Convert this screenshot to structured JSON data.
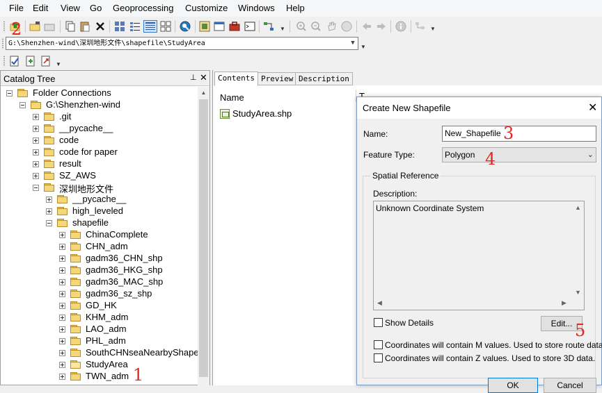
{
  "menu": [
    "File",
    "Edit",
    "View",
    "Go",
    "Geoprocessing",
    "Customize",
    "Windows",
    "Help"
  ],
  "location_path": "G:\\Shenzhen-wind\\深圳地形文件\\shapefile\\StudyArea",
  "catalog": {
    "title": "Catalog Tree",
    "pin": "⊥",
    "close": "✕",
    "nodes": [
      {
        "label": "Folder Connections",
        "level": 0,
        "expanded": true
      },
      {
        "label": "G:\\Shenzhen-wind",
        "level": 1,
        "expanded": true
      },
      {
        "label": ".git",
        "level": 2,
        "expanded": false
      },
      {
        "label": "__pycache__",
        "level": 2,
        "expanded": false
      },
      {
        "label": "code",
        "level": 2,
        "expanded": false
      },
      {
        "label": "code for paper",
        "level": 2,
        "expanded": false
      },
      {
        "label": "result",
        "level": 2,
        "expanded": false
      },
      {
        "label": "SZ_AWS",
        "level": 2,
        "expanded": false
      },
      {
        "label": "深圳地形文件",
        "level": 2,
        "expanded": true
      },
      {
        "label": "__pycache__",
        "level": 3,
        "expanded": false
      },
      {
        "label": "high_leveled",
        "level": 3,
        "expanded": false
      },
      {
        "label": "shapefile",
        "level": 3,
        "expanded": true
      },
      {
        "label": "ChinaComplete",
        "level": 4,
        "expanded": false
      },
      {
        "label": "CHN_adm",
        "level": 4,
        "expanded": false
      },
      {
        "label": "gadm36_CHN_shp",
        "level": 4,
        "expanded": false
      },
      {
        "label": "gadm36_HKG_shp",
        "level": 4,
        "expanded": false
      },
      {
        "label": "gadm36_MAC_shp",
        "level": 4,
        "expanded": false
      },
      {
        "label": "gadm36_sz_shp",
        "level": 4,
        "expanded": false
      },
      {
        "label": "GD_HK",
        "level": 4,
        "expanded": false
      },
      {
        "label": "KHM_adm",
        "level": 4,
        "expanded": false
      },
      {
        "label": "LAO_adm",
        "level": 4,
        "expanded": false
      },
      {
        "label": "PHL_adm",
        "level": 4,
        "expanded": false
      },
      {
        "label": "SouthCHNseaNearbyShape",
        "level": 4,
        "expanded": false
      },
      {
        "label": "StudyArea",
        "level": 4,
        "expanded": false,
        "open": true
      },
      {
        "label": "TWN_adm",
        "level": 4,
        "expanded": false
      }
    ]
  },
  "contents": {
    "tabs": [
      "Contents",
      "Preview",
      "Description"
    ],
    "column_name": "Name",
    "column_type": "T",
    "files": [
      "StudyArea.shp"
    ]
  },
  "dialog": {
    "title": "Create New Shapefile",
    "close": "✕",
    "name_label": "Name:",
    "name_value": "New_Shapefile",
    "feature_type_label": "Feature Type:",
    "feature_type_value": "Polygon",
    "spatial_reference_label": "Spatial Reference",
    "description_label": "Description:",
    "description_text": "Unknown Coordinate System",
    "show_details_label": "Show Details",
    "edit_button": "Edit...",
    "m_values_label": "Coordinates will contain M values. Used to store route data.",
    "z_values_label": "Coordinates will contain Z values. Used to store 3D data.",
    "ok_button": "OK",
    "cancel_button": "Cancel"
  },
  "annotations": [
    "1",
    "2",
    "3",
    "4",
    "5"
  ]
}
